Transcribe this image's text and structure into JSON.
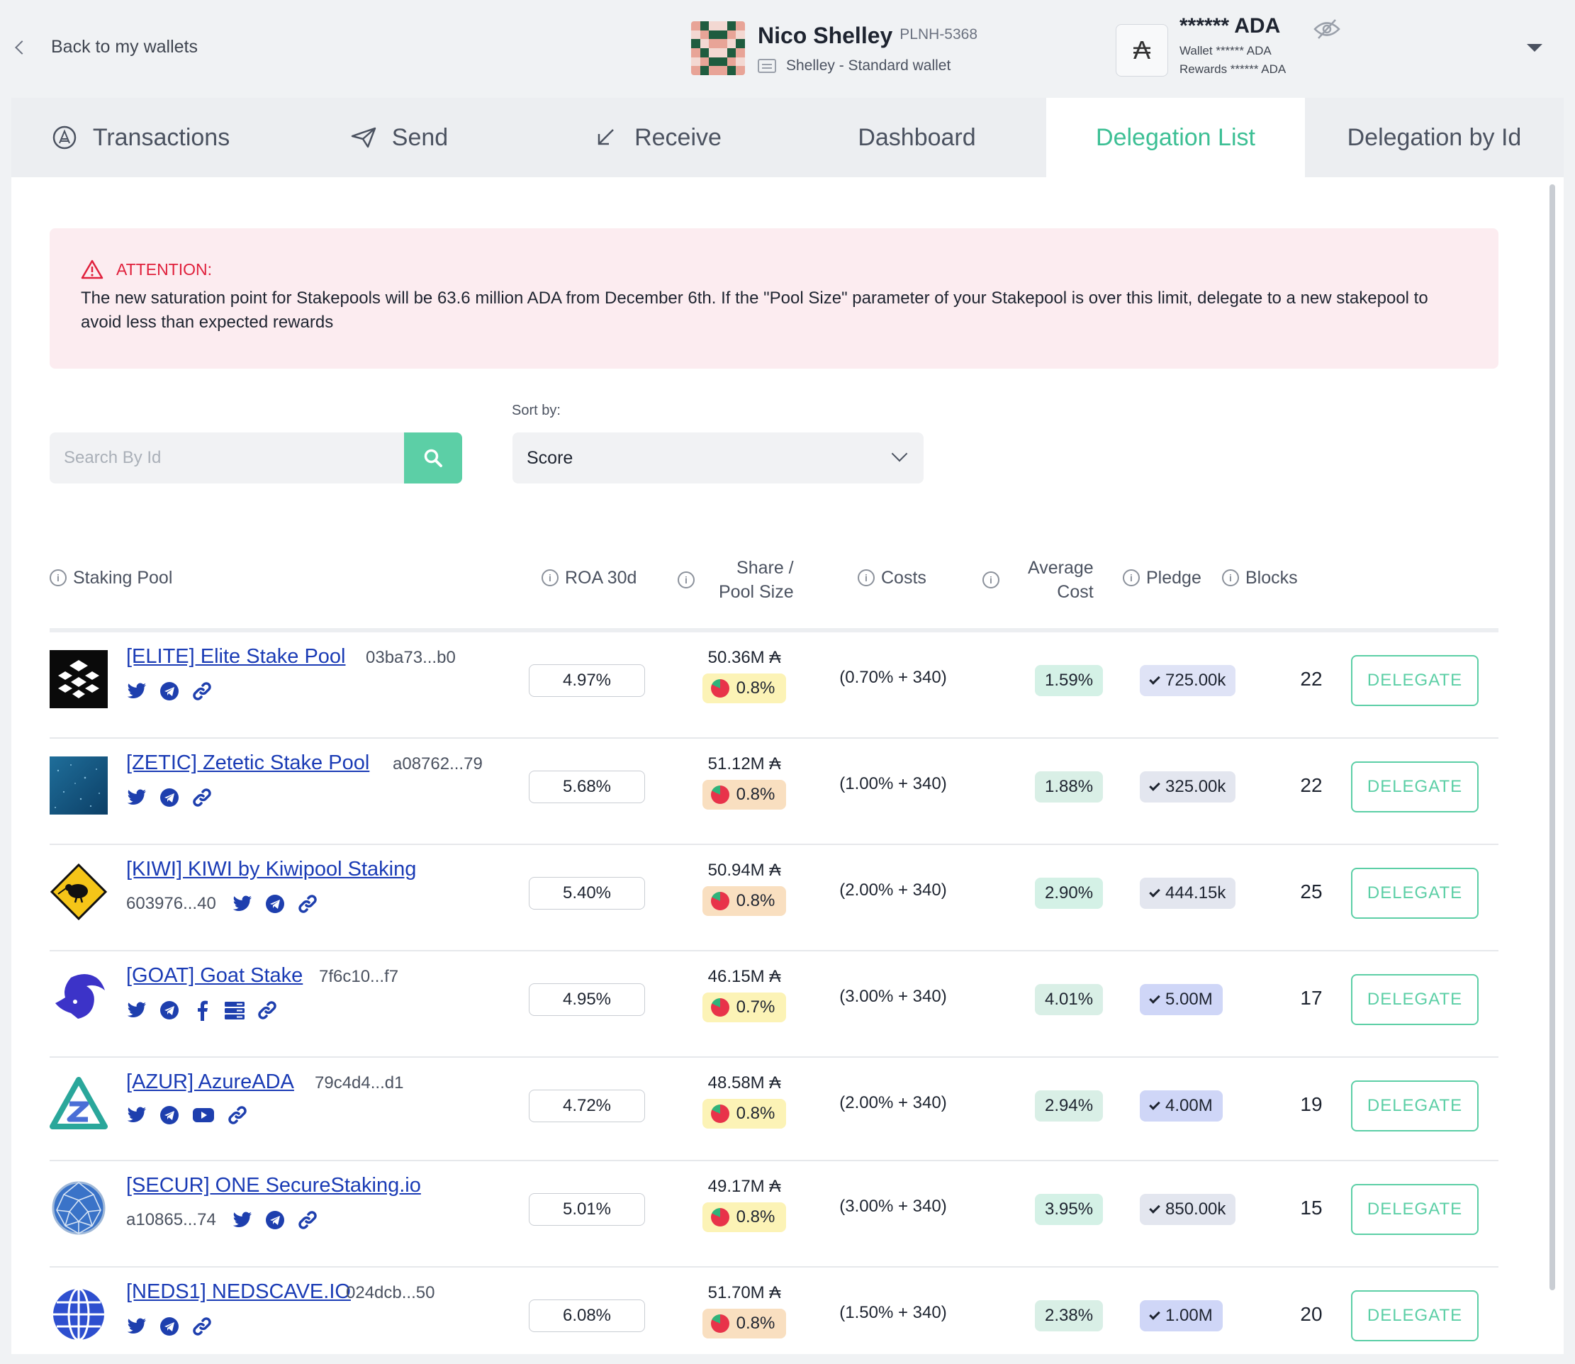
{
  "header": {
    "back_label": "Back to my wallets",
    "wallet_name": "Nico Shelley",
    "wallet_plate": "PLNH-5368",
    "wallet_type": "Shelley - Standard wallet",
    "balance_main": "****** ADA",
    "wallet_balance": "Wallet ****** ADA",
    "rewards_balance": "Rewards ****** ADA",
    "ada_symbol": "₳"
  },
  "tabs": [
    {
      "label": "Transactions",
      "icon": "ada-coin-icon"
    },
    {
      "label": "Send",
      "icon": "paper-plane-icon"
    },
    {
      "label": "Receive",
      "icon": "arrow-down-left-icon"
    },
    {
      "label": "Dashboard",
      "icon": ""
    },
    {
      "label": "Delegation List",
      "icon": "",
      "active": true
    },
    {
      "label": "Delegation by Id",
      "icon": ""
    }
  ],
  "alert": {
    "title": "ATTENTION:",
    "text": "The new saturation point for Stakepools will be 63.6 million ADA from December 6th. If the \"Pool Size\" parameter of your Stakepool is over this limit, delegate to a new stakepool to avoid less than expected rewards"
  },
  "search": {
    "placeholder": "Search By Id"
  },
  "sort": {
    "label": "Sort by:",
    "value": "Score"
  },
  "columns": {
    "pool": "Staking Pool",
    "roa": "ROA 30d",
    "share_1": "Share /",
    "share_2": "Pool Size",
    "costs": "Costs",
    "avg_1": "Average",
    "avg_2": "Cost",
    "pledge": "Pledge",
    "blocks": "Blocks"
  },
  "delegate_label": "DELEGATE",
  "colors": {
    "accent": "#5ccfa6",
    "active_tab": "#3cbf94",
    "link": "#1a3bb5",
    "alert_bg": "#fcecf0",
    "alert_title": "#e0203c"
  },
  "pools": [
    {
      "name": "[ELITE] Elite Stake Pool",
      "id": "03ba73...b0",
      "roa": "4.97%",
      "pool_size": "50.36M ₳",
      "saturation": "0.8%",
      "costs": "(0.70% + 340)",
      "avg_cost": "1.59%",
      "pledge": "725.00k",
      "blocks": "22",
      "socials": [
        "twitter",
        "telegram",
        "link"
      ]
    },
    {
      "name": "[ZETIC] Zetetic Stake Pool",
      "id": "a08762...79",
      "roa": "5.68%",
      "pool_size": "51.12M ₳",
      "saturation": "0.8%",
      "costs": "(1.00% + 340)",
      "avg_cost": "1.88%",
      "pledge": "325.00k",
      "blocks": "22",
      "socials": [
        "twitter",
        "telegram",
        "link"
      ]
    },
    {
      "name": "[KIWI] KIWI by Kiwipool Staking",
      "id": "603976...40",
      "roa": "5.40%",
      "pool_size": "50.94M ₳",
      "saturation": "0.8%",
      "costs": "(2.00% + 340)",
      "avg_cost": "2.90%",
      "pledge": "444.15k",
      "blocks": "25",
      "socials": [
        "twitter",
        "telegram",
        "link"
      ]
    },
    {
      "name": "[GOAT] Goat Stake",
      "id": "7f6c10...f7",
      "roa": "4.95%",
      "pool_size": "46.15M ₳",
      "saturation": "0.7%",
      "costs": "(3.00% + 340)",
      "avg_cost": "4.01%",
      "pledge": "5.00M",
      "blocks": "17",
      "socials": [
        "twitter",
        "telegram",
        "facebook",
        "server",
        "link"
      ]
    },
    {
      "name": "[AZUR] AzureADA",
      "id": "79c4d4...d1",
      "roa": "4.72%",
      "pool_size": "48.58M ₳",
      "saturation": "0.8%",
      "costs": "(2.00% + 340)",
      "avg_cost": "2.94%",
      "pledge": "4.00M",
      "blocks": "19",
      "socials": [
        "twitter",
        "telegram",
        "youtube",
        "link"
      ]
    },
    {
      "name": "[SECUR] ONE SecureStaking.io",
      "id": "a10865...74",
      "roa": "5.01%",
      "pool_size": "49.17M ₳",
      "saturation": "0.8%",
      "costs": "(3.00% + 340)",
      "avg_cost": "3.95%",
      "pledge": "850.00k",
      "blocks": "15",
      "socials": [
        "twitter",
        "telegram",
        "link"
      ]
    },
    {
      "name": "[NEDS1] NEDSCAVE.IO",
      "id": "024dcb...50",
      "roa": "6.08%",
      "pool_size": "51.70M ₳",
      "saturation": "0.8%",
      "costs": "(1.50% + 340)",
      "avg_cost": "2.38%",
      "pledge": "1.00M",
      "blocks": "20",
      "socials": [
        "twitter",
        "telegram",
        "link"
      ]
    }
  ]
}
